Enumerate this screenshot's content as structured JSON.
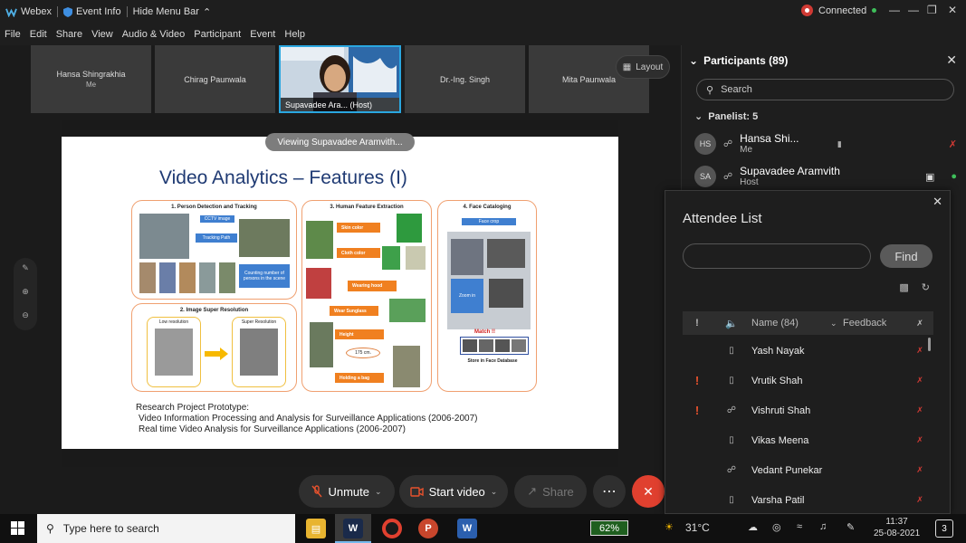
{
  "titlebar": {
    "app_name": "Webex",
    "event_info": "Event Info",
    "hide_menu": "Hide Menu Bar",
    "connection": "Connected"
  },
  "menu": [
    "File",
    "Edit",
    "Share",
    "View",
    "Audio & Video",
    "Participant",
    "Event",
    "Help"
  ],
  "thumbnails": {
    "t1_name": "Hansa Shingrakhia",
    "t1_me": "Me",
    "t2_name": "Chirag Paunwala",
    "host_name": "Supavadee Ara... (Host)",
    "t4_name": "Dr.-Ing. Singh",
    "t5_name": "Mita Paunwala"
  },
  "layout_label": "Layout",
  "viewing_label": "Viewing Supavadee Aramvith...",
  "slide": {
    "title": "Video Analytics – Features (I)",
    "box1_title": "1. Person Detection and Tracking",
    "box1_tag1": "CCTV image",
    "box1_tag2": "Tracking Path",
    "box1_tag3": "Counting number of persons in the scene",
    "box2_title": "2. Image Super Resolution",
    "box2_low": "Low resolution",
    "box2_super": "Super Resolution",
    "box3_title": "3. Human Feature Extraction",
    "box3_tags": [
      "Skin color",
      "Cloth color",
      "Wearing hood",
      "Wear Sunglass",
      "Height",
      "Holding a bag"
    ],
    "box3_height_value": "175 cm.",
    "box4_title": "4. Face Cataloging",
    "box4_facecrop": "Face crop",
    "box4_zoom": "Zoom in",
    "box4_match": "Match !!",
    "box4_store": "Store in Face Database",
    "research_line1": "Research Project Prototype:",
    "research_line2": "Video Information Processing and Analysis for Surveillance Applications (2006-2007)",
    "research_line3": "Real time Video Analysis for Surveillance Applications (2006-2007)"
  },
  "controls": {
    "unmute": "Unmute",
    "start_video": "Start video",
    "share": "Share",
    "more": "⋯",
    "leave": "✕"
  },
  "participants": {
    "title": "Participants (89)",
    "search_placeholder": "Search",
    "panelist_head": "Panelist: 5",
    "p1_initials": "HS",
    "p1_name": "Hansa Shi...",
    "p1_sub": "Me",
    "p2_initials": "SA",
    "p2_name": "Supavadee Aramvith",
    "p2_sub": "Host"
  },
  "attendee_list": {
    "title": "Attendee List",
    "find": "Find",
    "col_name": "Name (84)",
    "col_feedback": "Feedback",
    "rows": [
      {
        "alert": "",
        "name": "Yash Nayak"
      },
      {
        "alert": "!",
        "name": "Vrutik Shah"
      },
      {
        "alert": "!",
        "name": "Vishruti Shah"
      },
      {
        "alert": "",
        "name": "Vikas Meena"
      },
      {
        "alert": "",
        "name": "Vedant Punekar"
      },
      {
        "alert": "",
        "name": "Varsha Patil"
      }
    ]
  },
  "taskbar": {
    "search_placeholder": "Type here to search",
    "battery": "62%",
    "weather": "31°C",
    "time": "11:37",
    "date": "25-08-2021",
    "notifications": "3"
  }
}
